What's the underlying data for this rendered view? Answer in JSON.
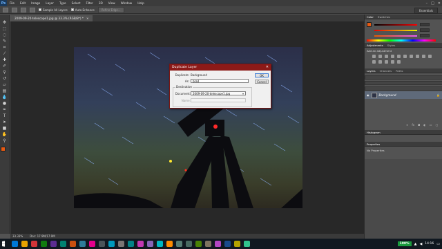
{
  "menubar": {
    "logo": "Ps",
    "items": [
      "File",
      "Edit",
      "Image",
      "Layer",
      "Type",
      "Select",
      "Filter",
      "3D",
      "View",
      "Window",
      "Help"
    ],
    "controls": [
      "–",
      "□",
      "✕"
    ]
  },
  "options": {
    "sample_all_layers": "Sample All Layers",
    "auto_enhance": "Auto-Enhance",
    "refine_edge": "Refine Edge...",
    "workspace": "Essentials"
  },
  "document": {
    "tab_title": "2009-09-20-telescope1.jpg @ 33.3% (RGB/8*) *",
    "tab_close": "×"
  },
  "status": {
    "zoom": "33.33%",
    "doc_size": "Doc: 17.9M/17.9M"
  },
  "panels": {
    "color_tabs": [
      "Color",
      "Swatches"
    ],
    "adjustments_tabs": [
      "Adjustments",
      "Styles"
    ],
    "adjustments_hint": "Add an adjustment",
    "layers_tabs": [
      "Layers",
      "Channels",
      "Paths"
    ],
    "layer_name": "Background",
    "histogram_tab": "Histogram",
    "properties_tab": "Properties",
    "properties_text": "No Properties"
  },
  "dialog": {
    "title": "Duplicate Layer",
    "close": "✕",
    "duplicate_label": "Duplicate:",
    "duplicate_value": "Background",
    "as_label": "As:",
    "as_value": "brad",
    "ok": "OK",
    "cancel": "Cancel",
    "destination_label": "Destination",
    "document_label": "Document:",
    "document_value": "2009-09-20-telescope1.jpg",
    "name_label": "Name:"
  },
  "taskbar": {
    "battery": "100%",
    "time": "14:16",
    "app_colors": [
      "#0078d7",
      "#e8a200",
      "#d13438",
      "#107c10",
      "#5c2d91",
      "#008272",
      "#ca5010",
      "#2d7d9a",
      "#e3008c",
      "#4a5459",
      "#0099bc",
      "#7a7574",
      "#038387",
      "#c239b3",
      "#8764b8",
      "#00b7c3",
      "#ff8c00",
      "#567c73",
      "#486860",
      "#498205",
      "#7e735f",
      "#b146c2",
      "#1a4b8c",
      "#b5a300",
      "#31c48d"
    ]
  },
  "colors": {
    "foreground": "#e85a12",
    "background": "#ffffff",
    "dialog_title": "#8c1a18"
  }
}
